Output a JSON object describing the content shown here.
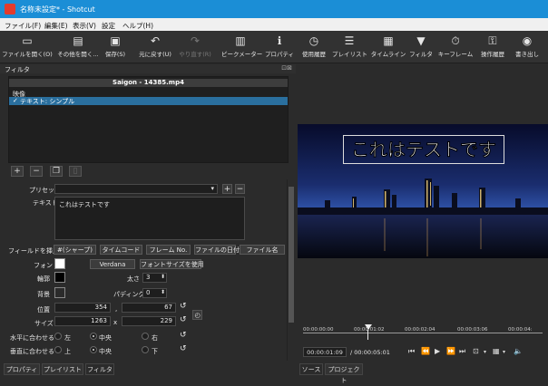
{
  "window": {
    "title": "名称未設定* - Shotcut"
  },
  "menu": [
    "ファイル(F)",
    "編集(E)",
    "表示(V)",
    "設定",
    "ヘルプ(H)"
  ],
  "toolbar": [
    {
      "label": "ファイルを開く(O)",
      "icon": "open-file-icon"
    },
    {
      "label": "その他を開く…",
      "icon": "open-other-icon"
    },
    {
      "label": "保存(S)",
      "icon": "save-icon"
    },
    {
      "label": "元に戻す(U)",
      "icon": "undo-icon"
    },
    {
      "label": "やり直す(R)",
      "icon": "redo-icon",
      "disabled": true
    },
    {
      "label": "ピークメーター",
      "icon": "peak-meter-icon"
    },
    {
      "label": "プロパティ",
      "icon": "properties-icon"
    },
    {
      "label": "使用履歴",
      "icon": "history-icon"
    },
    {
      "label": "プレイリスト",
      "icon": "playlist-icon"
    },
    {
      "label": "タイムライン",
      "icon": "timeline-icon"
    },
    {
      "label": "フィルタ",
      "icon": "filter-icon"
    },
    {
      "label": "キーフレーム",
      "icon": "keyframes-icon"
    },
    {
      "label": "操作履歴",
      "icon": "operation-history-icon"
    },
    {
      "label": "書き出し",
      "icon": "export-icon"
    }
  ],
  "filter_panel": {
    "title": "フィルタ",
    "clip_name": "Saigon - 14385.mp4",
    "category": "映像",
    "filter_item": "テキスト: シンプル"
  },
  "props": {
    "preset_label": "プリセット",
    "text_label": "テキスト",
    "text_value": "これはテストです",
    "insert_label": "フィールドを挿入",
    "insert_buttons": [
      "#(シャープ)",
      "タイムコード",
      "フレーム No.",
      "ファイルの日付",
      "ファイル名"
    ],
    "font_label": "フォント",
    "font_name": "Verdana",
    "font_size_btn": "フォントサイズを使用",
    "outline_label": "輪郭",
    "thickness_label": "太さ",
    "thickness_value": "3",
    "bg_label": "背景",
    "padding_label": "パディング",
    "padding_value": "0",
    "position_label": "位置",
    "position_x": "354",
    "position_y": "67",
    "size_label": "サイズ",
    "size_w": "1263",
    "size_x_sep": "x",
    "size_h": "229",
    "halign_label": "水平に合わせる",
    "halign_options": [
      "左",
      "中央",
      "右"
    ],
    "halign_selected": 1,
    "valign_label": "垂直に合わせる",
    "valign_options": [
      "上",
      "中央",
      "下"
    ],
    "valign_selected": 1
  },
  "bottom_tabs_left": [
    "プロパティ",
    "プレイリスト",
    "フィルタ"
  ],
  "player": {
    "overlay_text": "これはテストです",
    "ruler_labels": [
      "00:00:00:00",
      "00:00:01:02",
      "00:00:02:04",
      "00:00:03:06",
      "00:00:04:"
    ],
    "current_time": "00:00:01:09",
    "duration": "/ 00:00:05:01"
  },
  "bottom_tabs_right": [
    "ソース",
    "プロジェクト"
  ],
  "colors": {
    "accent": "#2a6f9e",
    "titlebar": "#1b8ed6",
    "font_color": "#ffffff",
    "outline_color": "#000000",
    "bg_color": "#2b2b2b"
  }
}
